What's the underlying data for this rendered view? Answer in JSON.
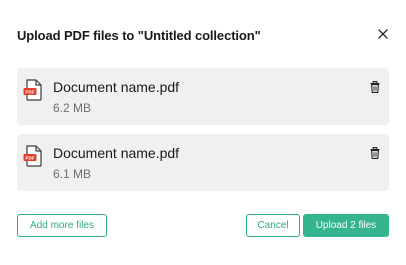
{
  "dialog": {
    "title": "Upload PDF files to \"Untitled collection\"",
    "close_icon": "close-icon"
  },
  "files": [
    {
      "name": "Document name.pdf",
      "size": "6.2 MB",
      "icon_label": "PDF",
      "icon": "pdf-file-icon",
      "action_icon": "trash-icon"
    },
    {
      "name": "Document name.pdf",
      "size": "6.1 MB",
      "icon_label": "PDF",
      "icon": "pdf-file-icon",
      "action_icon": "trash-icon"
    }
  ],
  "footer": {
    "add_more_label": "Add more files",
    "cancel_label": "Cancel",
    "upload_label": "Upload 2 files"
  },
  "colors": {
    "accent": "#34b48f",
    "accent_outline": "#2fa98a",
    "card_bg": "#f0f0f0",
    "pdf_red": "#e2412f"
  }
}
